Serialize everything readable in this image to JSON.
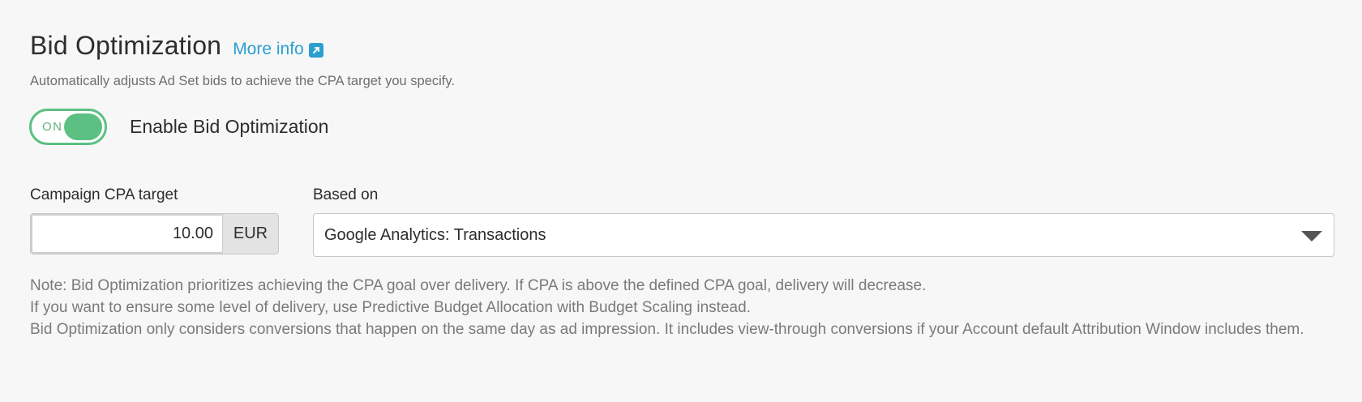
{
  "header": {
    "title": "Bid Optimization",
    "more_info": "More info",
    "subtitle": "Automatically adjusts Ad Set bids to achieve the CPA target you specify."
  },
  "toggle": {
    "state_text": "ON",
    "label": "Enable Bid Optimization",
    "checked": true
  },
  "cpa": {
    "label": "Campaign CPA target",
    "value": "10.00",
    "unit": "EUR"
  },
  "based_on": {
    "label": "Based on",
    "selected": "Google Analytics: Transactions"
  },
  "notes": [
    "Note: Bid Optimization prioritizes achieving the CPA goal over delivery. If CPA is above the defined CPA goal, delivery will decrease.",
    "If you want to ensure some level of delivery, use Predictive Budget Allocation with Budget Scaling instead.",
    "Bid Optimization only considers conversions that happen on the same day as ad impression. It includes view-through conversions if your Account default Attribution Window includes them."
  ],
  "colors": {
    "accent": "#2a9fd0",
    "toggle_on": "#5cc083"
  },
  "icons": {
    "more_info": "external-link-icon",
    "select": "chevron-down-icon"
  }
}
